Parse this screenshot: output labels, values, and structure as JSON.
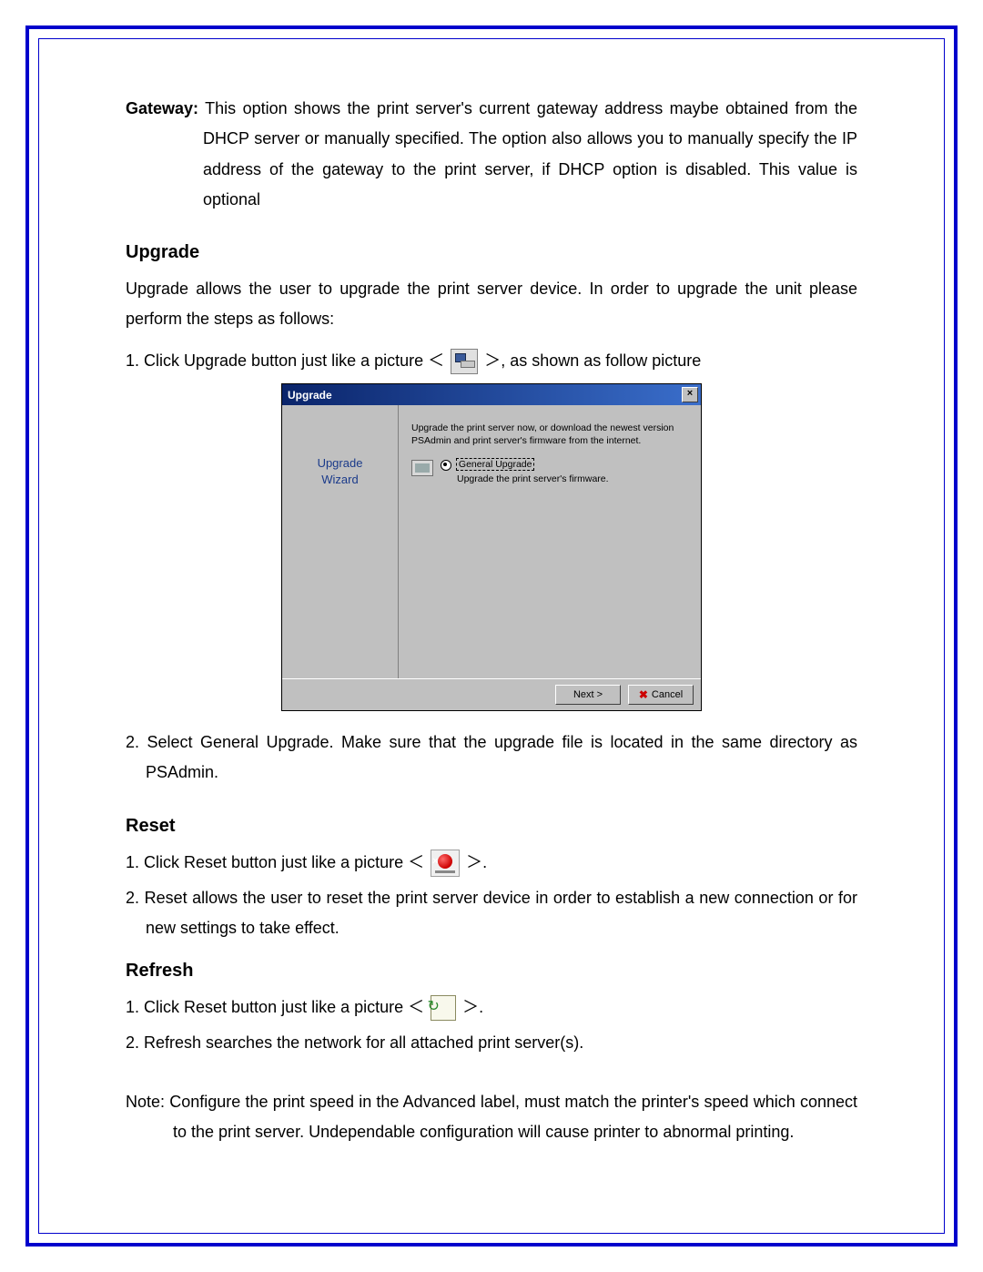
{
  "gateway": {
    "label": "Gateway:",
    "text": "This option shows the print server's current gateway address maybe obtained from the DHCP server or manually specified. The option also allows you to manually specify the IP address of the gateway to the print server, if DHCP option is disabled. This value is optional"
  },
  "upgrade": {
    "heading": "Upgrade",
    "intro": "Upgrade allows the user to upgrade the print server device. In order to upgrade the unit please perform the steps as follows:",
    "step1_pre": "1. Click Upgrade button just like a picture ＜",
    "step1_post": "＞, as shown as follow picture",
    "step2": "2. Select General Upgrade. Make sure that the upgrade file is located in the same directory as PSAdmin."
  },
  "dialog": {
    "title": "Upgrade",
    "close": "×",
    "wizard_line1": "Upgrade",
    "wizard_line2": "Wizard",
    "desc": "Upgrade the print server now, or download the newest version PSAdmin and print server's firmware from the internet.",
    "option_label": "General Upgrade",
    "option_sub": "Upgrade the print server's firmware.",
    "next": "Next >",
    "cancel": "Cancel"
  },
  "reset": {
    "heading": "Reset",
    "step1_pre": "1. Click Reset button just like a picture ＜",
    "step1_post": "＞.",
    "step2": "2. Reset allows the user to reset the print server device in order to establish a new connection or for new settings to take effect."
  },
  "refresh": {
    "heading": "Refresh",
    "step1_pre": "1. Click Reset button just like a picture ＜",
    "step1_post": "＞.",
    "step2": "2. Refresh searches the network for all attached print server(s)."
  },
  "note": {
    "label": "Note:",
    "text": "Configure the print speed in the Advanced label, must match the printer's speed which connect to the print server. Undependable configuration will cause printer to abnormal printing."
  }
}
